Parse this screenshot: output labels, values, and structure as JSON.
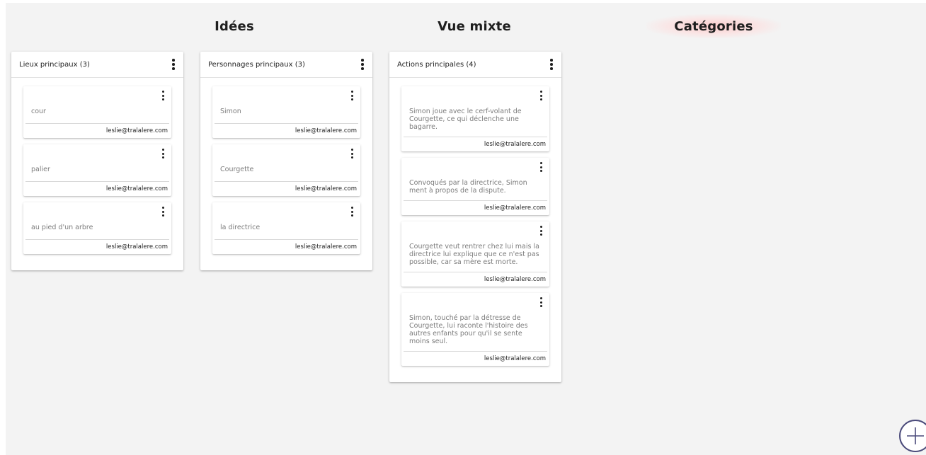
{
  "tabs": [
    {
      "label": "Idées"
    },
    {
      "label": "Vue mixte"
    },
    {
      "label": "Catégories"
    }
  ],
  "columns": [
    {
      "title": "Lieux principaux (3)",
      "cards": [
        {
          "text": "cour",
          "author": "leslie@tralalere.com"
        },
        {
          "text": "palier",
          "author": "leslie@tralalere.com"
        },
        {
          "text": "au pied d'un arbre",
          "author": "leslie@tralalere.com"
        }
      ]
    },
    {
      "title": "Personnages principaux (3)",
      "cards": [
        {
          "text": "Simon",
          "author": "leslie@tralalere.com"
        },
        {
          "text": "Courgette",
          "author": "leslie@tralalere.com"
        },
        {
          "text": "la directrice",
          "author": "leslie@tralalere.com"
        }
      ]
    },
    {
      "title": "Actions principales (4)",
      "cards": [
        {
          "text": "Simon joue avec le cerf-volant de Courgette, ce qui déclenche une bagarre.",
          "author": "leslie@tralalere.com"
        },
        {
          "text": "Convoqués par la directrice, Simon ment à propos de la dispute.",
          "author": "leslie@tralalere.com"
        },
        {
          "text": "Courgette veut rentrer chez lui mais la directrice lui explique que ce n'est pas possible, car sa mère est morte.",
          "author": "leslie@tralalere.com"
        },
        {
          "text": "Simon, touché par la détresse de Courgette, lui raconte l'histoire des autres enfants pour qu'il se sente moins seul.",
          "author": "leslie@tralalere.com"
        }
      ]
    }
  ],
  "icons": {
    "kebab": "more-vertical-icon",
    "add": "plus-circle-icon"
  },
  "colors": {
    "background": "#f3f3f3",
    "active_tab_glow": "#fcc8c8",
    "add_button_stroke": "#4a4a7a"
  }
}
